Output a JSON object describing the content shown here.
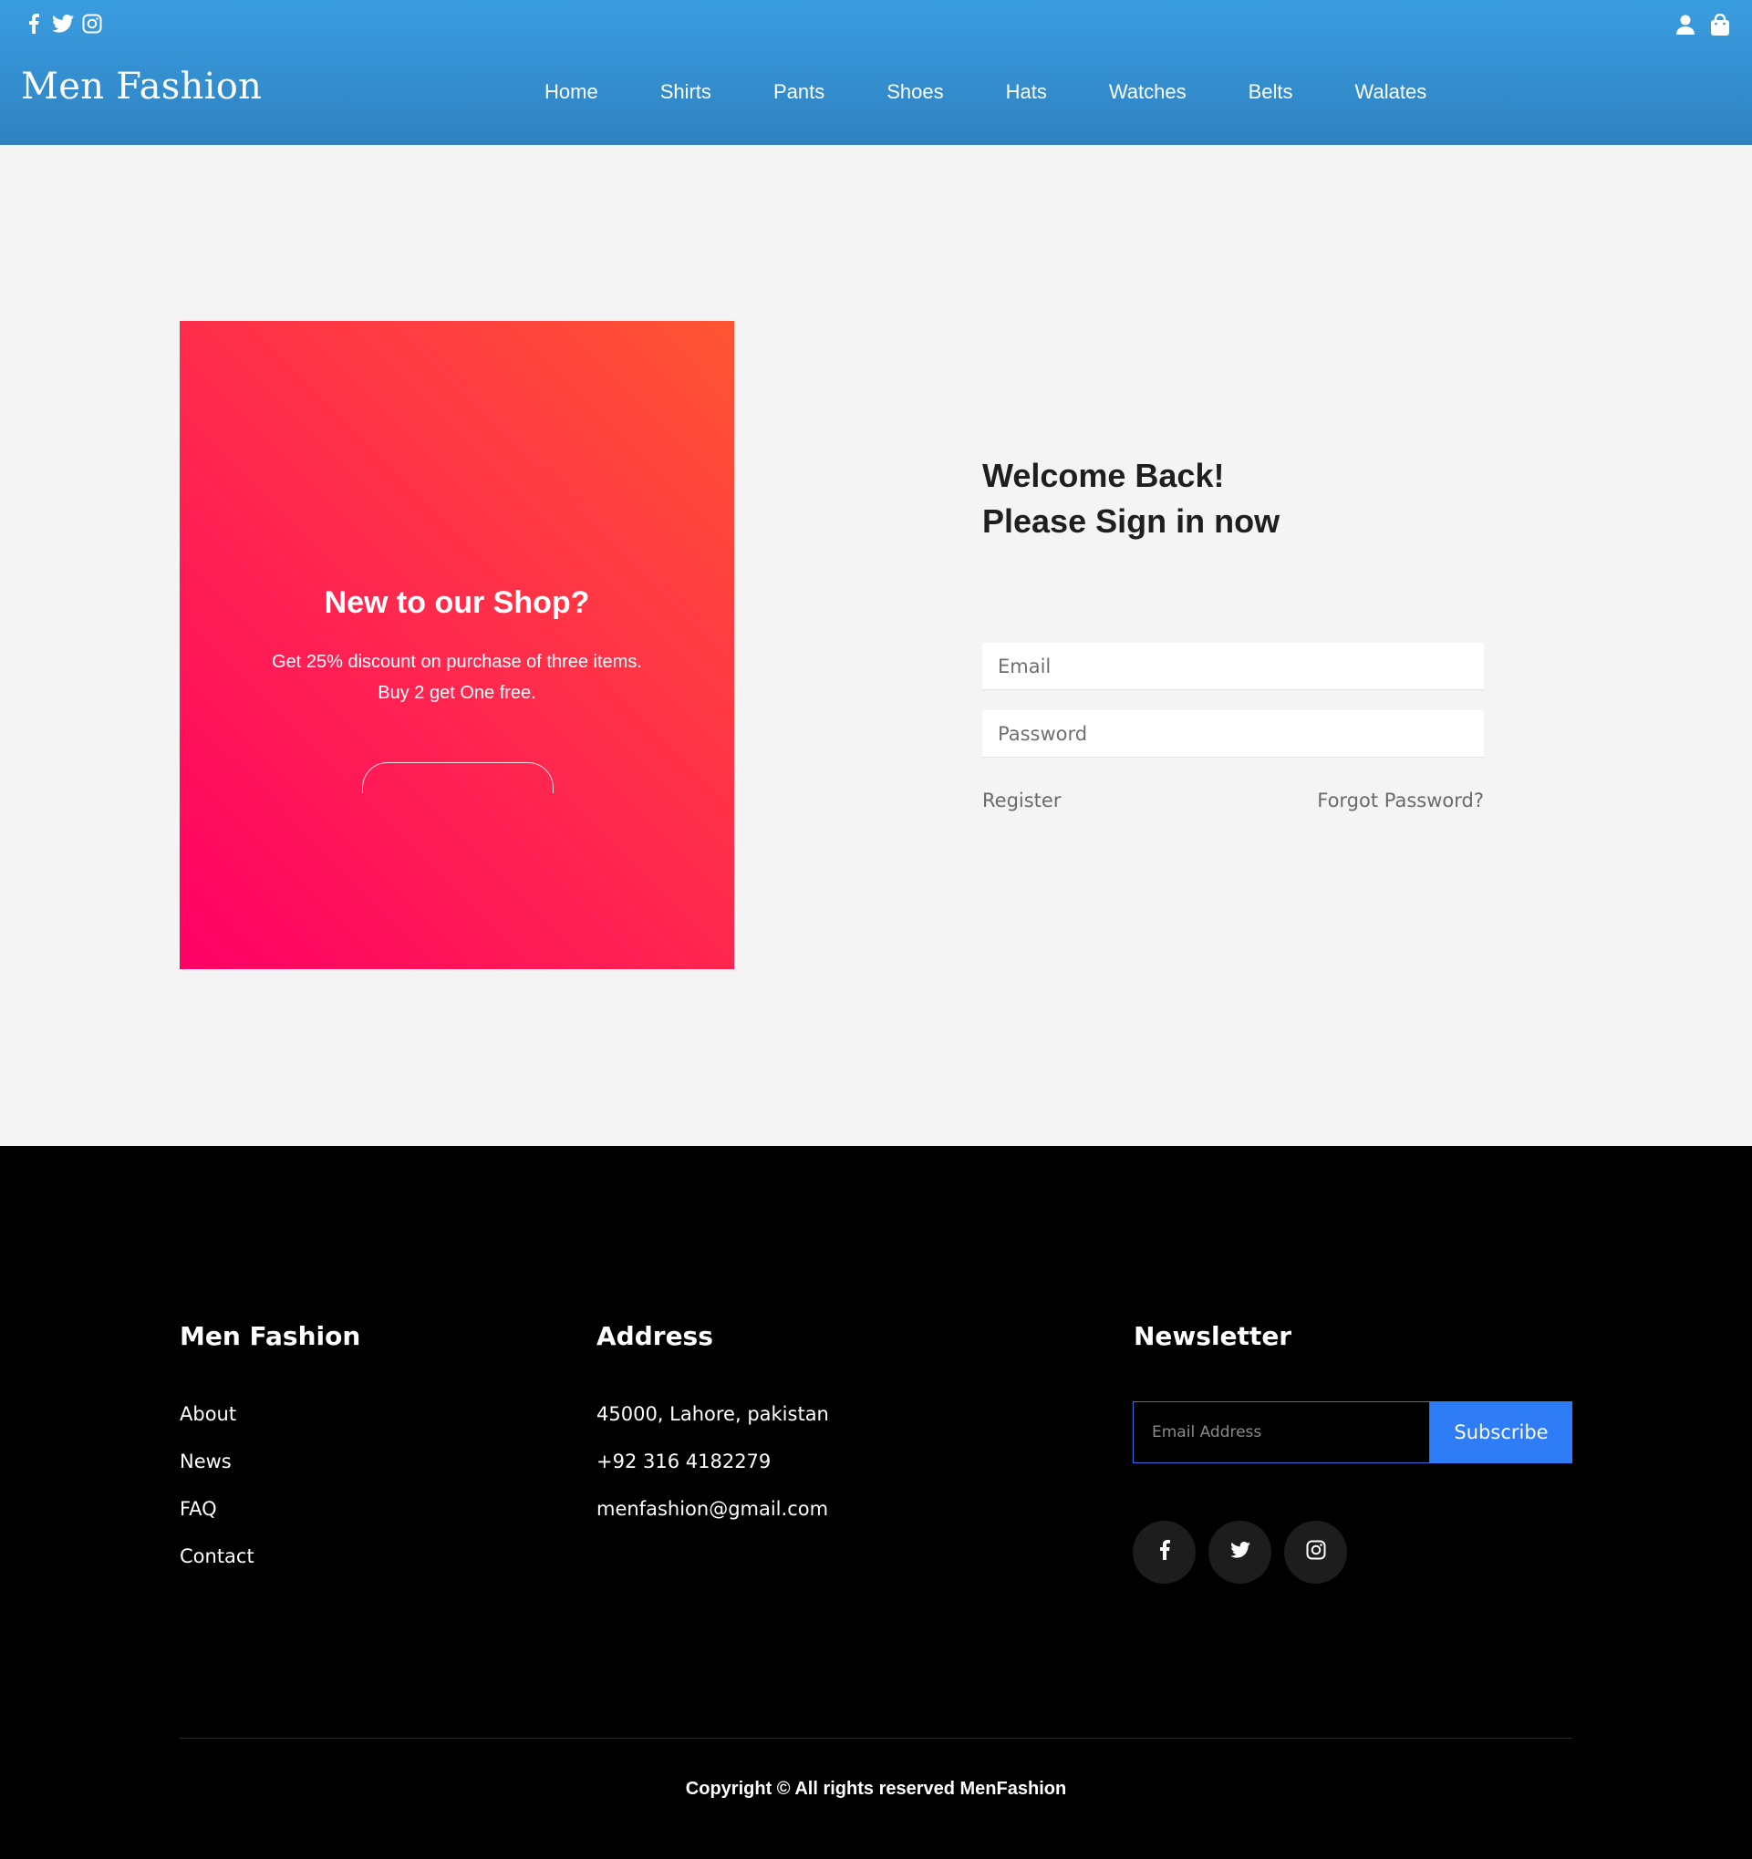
{
  "header": {
    "brand": "Men Fashion",
    "nav": [
      "Home",
      "Shirts",
      "Pants",
      "Shoes",
      "Hats",
      "Watches",
      "Belts",
      "Walates"
    ],
    "social_icons": [
      "facebook-icon",
      "twitter-icon",
      "instagram-icon"
    ],
    "right_icons": [
      "user-icon",
      "shopping-bag-icon"
    ],
    "color": "#3591d3"
  },
  "promo": {
    "title": "New to our Shop?",
    "line1": "Get 25% discount on purchase of three items.",
    "line2": "Buy 2 get One free.",
    "gradient": [
      "#ff0066",
      "#ff5533"
    ]
  },
  "signin": {
    "heading_line1": "Welcome Back!",
    "heading_line2": "Please Sign in now",
    "email_placeholder": "Email",
    "password_placeholder": "Password",
    "register": "Register",
    "forgot": "Forgot Password?"
  },
  "footer": {
    "col1": {
      "heading": "Men Fashion",
      "links": [
        "About",
        "News",
        "FAQ",
        "Contact"
      ]
    },
    "col2": {
      "heading": "Address",
      "lines": [
        "45000, Lahore, pakistan",
        "+92 316 4182279",
        "menfashion@gmail.com"
      ]
    },
    "col3": {
      "heading": "Newsletter",
      "email_placeholder": "Email Address",
      "subscribe": "Subscribe",
      "social_icons": [
        "facebook-icon",
        "twitter-icon",
        "instagram-icon"
      ]
    },
    "copyright": "Copyright © All rights reserved MenFashion",
    "accent": "#2f7df6"
  }
}
